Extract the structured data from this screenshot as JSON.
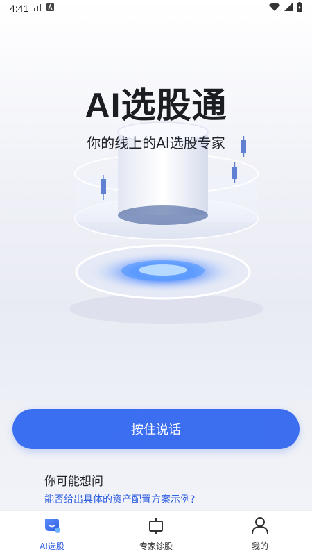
{
  "status_bar": {
    "time": "4:41",
    "icons": [
      "signal-bars-icon",
      "a-badge-icon",
      "wifi-icon",
      "signal-icon",
      "battery-icon"
    ]
  },
  "hero": {
    "title": "AI选股通",
    "subtitle": "你的线上的AI选股专家"
  },
  "main": {
    "talk_button_label": "按住说话",
    "suggestion_title": "你可能想问",
    "suggestion_link": "能否给出具体的资产配置方案示例?"
  },
  "nav": {
    "items": [
      {
        "label": "AI选股",
        "icon": "ai-chat-icon",
        "active": true
      },
      {
        "label": "专家诊股",
        "icon": "expert-diagnosis-icon",
        "active": false
      },
      {
        "label": "我的",
        "icon": "person-icon",
        "active": false
      }
    ]
  },
  "colors": {
    "accent": "#3a6ff1",
    "link": "#2f5fe0",
    "active_nav": "#2f5fe0"
  }
}
